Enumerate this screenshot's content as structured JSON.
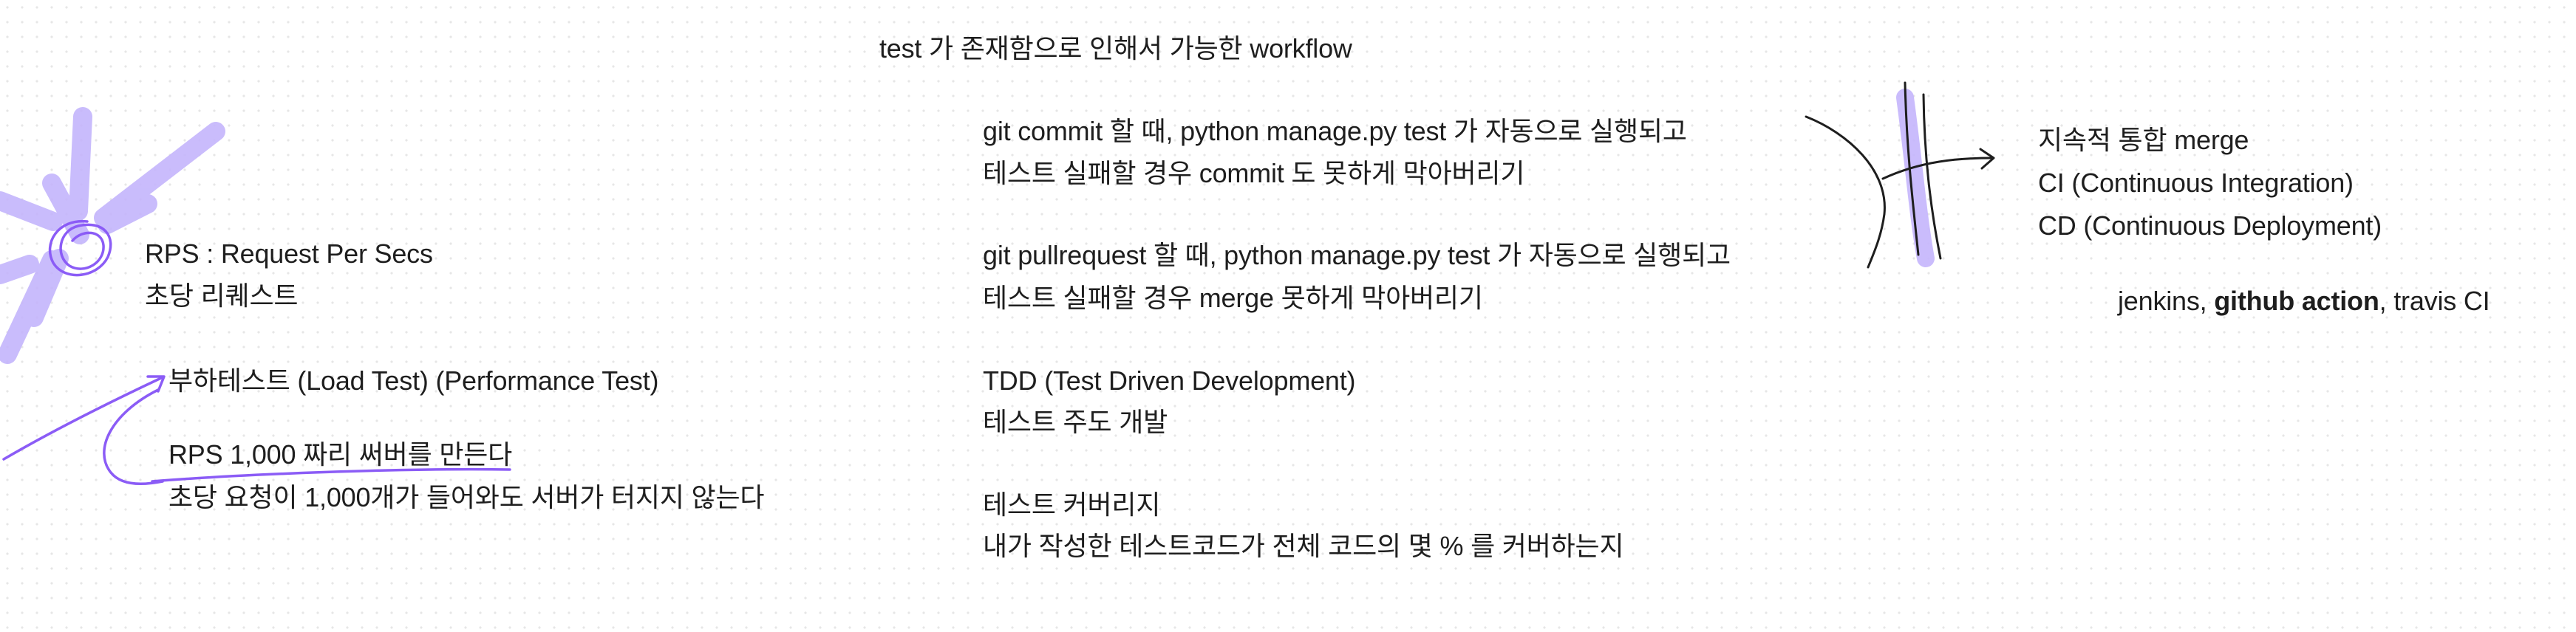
{
  "board": {
    "title": "test 가 존재함으로 인해서 가능한 workflow",
    "rps": {
      "term": "RPS : Request Per Secs",
      "meaning": "초당 리퀘스트"
    },
    "load_test": {
      "heading": "부하테스트 (Load Test) (Performance Test)",
      "example": "RPS 1,000 짜리 써버를 만든다",
      "example_detail": "초당 요청이 1,000개가 들어와도 서버가 터지지 않는다"
    },
    "workflow": {
      "commit_line1": "git commit 할 때, python manage.py test 가 자동으로 실행되고",
      "commit_line2": "테스트 실패할 경우 commit 도 못하게 막아버리기",
      "pr_line1": "git pullrequest 할 때, python manage.py test 가 자동으로 실행되고",
      "pr_line2": "테스트 실패할 경우 merge 못하게 막아버리기"
    },
    "tdd": {
      "heading": "TDD (Test Driven Development)",
      "meaning": "테스트 주도 개발"
    },
    "coverage": {
      "heading": "테스트 커버리지",
      "meaning": "내가 작성한 테스트코드가 전체 코드의 몇 % 를 커버하는지"
    },
    "ci_cd": {
      "line1": "지속적 통합 merge",
      "line2": "CI (Continuous Integration)",
      "line3": "CD (Continuous Deployment)"
    },
    "tools": {
      "jenkins": "jenkins, ",
      "github_action": "github action",
      "travis": ", travis CI"
    }
  },
  "colors": {
    "text": "#1e1e1e",
    "ink": "#1e1e1e",
    "highlighter": "#c4b5fc",
    "pen_purple": "#8b5cf6"
  },
  "icons": {
    "hashtag_sketch": "hash-sign-icon",
    "burst_sketch": "burst-icon",
    "curved_arrow": "curved-arrow-icon"
  }
}
